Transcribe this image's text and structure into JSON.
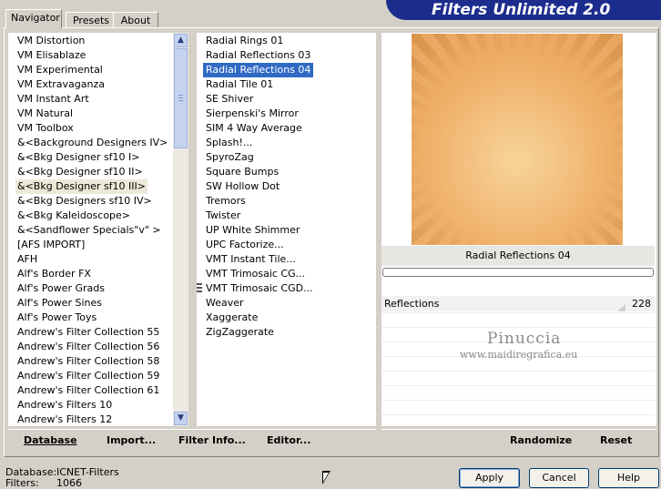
{
  "header": {
    "title": "Filters Unlimited 2.0"
  },
  "tabs": [
    {
      "label": "Navigator",
      "active": true
    },
    {
      "label": "Presets",
      "active": false
    },
    {
      "label": "About",
      "active": false
    }
  ],
  "categories": {
    "selected": "&<Bkg Designer sf10 III>",
    "items": [
      "VM Distortion",
      "VM Elisablaze",
      "VM Experimental",
      "VM Extravaganza",
      "VM Instant Art",
      "VM Natural",
      "VM Toolbox",
      "&<Background Designers IV>",
      "&<Bkg Designer sf10 I>",
      "&<Bkg Designer sf10 II>",
      "&<Bkg Designer sf10 III>",
      "&<Bkg Designers sf10 IV>",
      "&<Bkg Kaleidoscope>",
      "&<Sandflower Specials\"v\" >",
      "[AFS IMPORT]",
      "AFH",
      "Alf's Border FX",
      "Alf's Power Grads",
      "Alf's Power Sines",
      "Alf's Power Toys",
      "Andrew's Filter Collection 55",
      "Andrew's Filter Collection 56",
      "Andrew's Filter Collection 58",
      "Andrew's Filter Collection 59",
      "Andrew's Filter Collection 61",
      "Andrew's Filters 10",
      "Andrew's Filters 12"
    ]
  },
  "filters": {
    "selected": "Radial Reflections 04",
    "items": [
      "Radial  Rings 01",
      "Radial Reflections 03",
      "Radial Reflections 04",
      "Radial Tile 01",
      "SE Shiver",
      "Sierpenski's Mirror",
      "SIM 4 Way Average",
      "Splash!...",
      "SpyroZag",
      "Square Bumps",
      "SW Hollow Dot",
      "Tremors",
      "Twister",
      "UP White Shimmer",
      "UPC Factorize...",
      "VMT Instant Tile...",
      "VMT Trimosaic CG...",
      "VMT Trimosaic CGD...",
      "Weaver",
      "Xaggerate",
      "ZigZaggerate"
    ]
  },
  "preview": {
    "filter_name": "Radial Reflections 04",
    "colors": {
      "center": "#f7d49a",
      "edge": "#e69c4e"
    }
  },
  "parameters": [
    {
      "label": "Reflections",
      "value": "228"
    }
  ],
  "watermark": {
    "line1": "Pinuccia",
    "line2": "www.maidiregrafica.eu"
  },
  "left_toolbar": {
    "database": "Database",
    "import": "Import...",
    "filter_info": "Filter Info...",
    "editor": "Editor..."
  },
  "right_toolbar": {
    "randomize": "Randomize",
    "reset": "Reset"
  },
  "status": {
    "database_label": "Database:",
    "database_value": "ICNET-Filters",
    "filters_label": "Filters:",
    "filters_value": "1066"
  },
  "buttons": {
    "apply": "Apply",
    "cancel": "Cancel",
    "help": "Help"
  },
  "icons": {
    "scroll_up": "chevron-up-icon",
    "scroll_down": "chevron-down-icon"
  }
}
